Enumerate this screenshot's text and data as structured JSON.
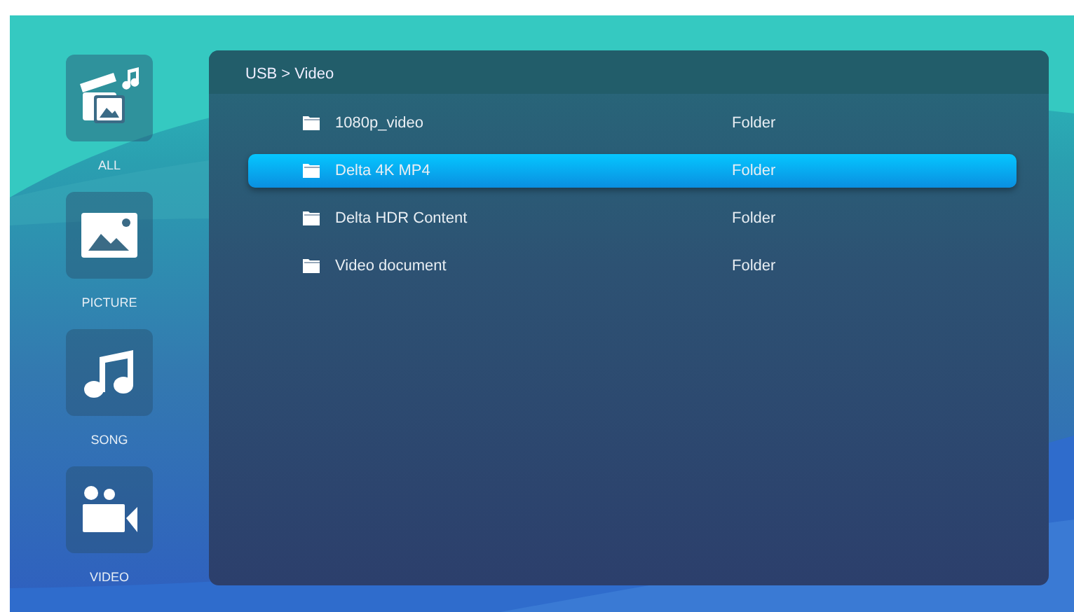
{
  "sidebar": {
    "items": [
      {
        "label": "ALL",
        "selected": false
      },
      {
        "label": "PICTURE",
        "selected": false
      },
      {
        "label": "SONG",
        "selected": false
      },
      {
        "label": "VIDEO",
        "selected": false
      }
    ]
  },
  "browser": {
    "breadcrumb": "USB > Video",
    "files": [
      {
        "name": "1080p_video",
        "type": "Folder",
        "selected": false
      },
      {
        "name": "Delta 4K MP4",
        "type": "Folder",
        "selected": true
      },
      {
        "name": "Delta HDR Content",
        "type": "Folder",
        "selected": false
      },
      {
        "name": "Video document",
        "type": "Folder",
        "selected": false
      }
    ]
  }
}
